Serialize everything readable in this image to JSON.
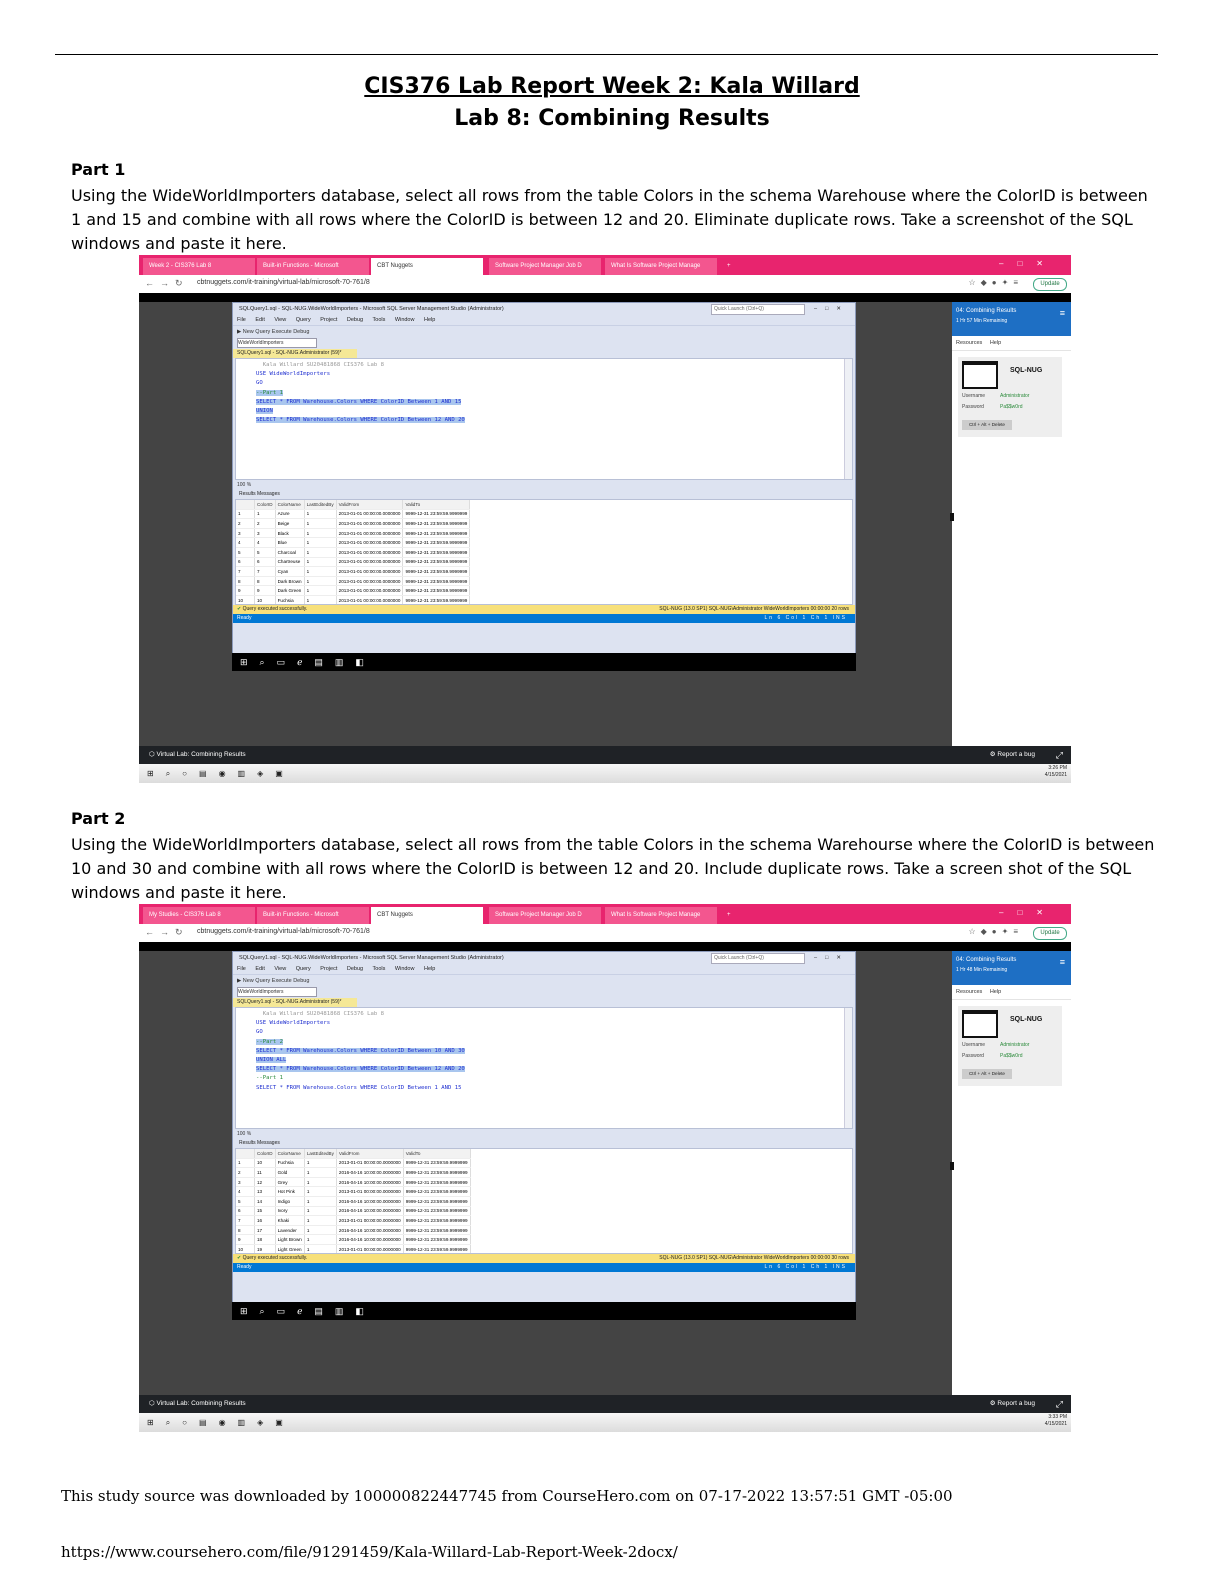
{
  "title1": "CIS376 Lab Report Week 2: Kala Willard",
  "title2": "Lab 8: Combining Results",
  "parts": [
    {
      "heading": "Part 1",
      "text": "Using the WideWorldImporters database, select all rows from the table Colors in the schema Warehouse where the ColorID is between 1 and 15 and combine with all rows where the ColorID is between 12 and 20. Eliminate duplicate rows. Take a screenshot of the SQL windows and paste it here.",
      "shot": {
        "tabs": [
          "Week 2 - CIS376 Lab 8",
          "Built-in Functions - Microsoft",
          "CBT Nuggets",
          "Software Project Manager Job D",
          "What Is Software Project Manage"
        ],
        "url": "cbtnuggets.com/it-training/virtual-lab/microsoft-70-761/8",
        "ssms_title": "SQLQuery1.sql - SQL-NUG.WideWorldImporters - Microsoft SQL Server Management Studio (Administrator)",
        "quick_launch": "Quick Launch (Ctrl+Q)",
        "menu": "File Edit View Query Project Debug Tools Window Help",
        "toolbar": "New Query   Execute   Debug",
        "db_selector": "WideWorldImporters",
        "doc_tab": "SQLQuery1.sql - SQL-NUG.Administrator (59)*",
        "code_lines": [
          {
            "text": "Kala Willard SU20481868 CIS376 Lab 8",
            "cls": "gr",
            "indent": "  "
          },
          {
            "text": "",
            "cls": "",
            "indent": ""
          },
          {
            "text": "USE WideWorldImporters",
            "cls": "kw",
            "indent": ""
          },
          {
            "text": "GO",
            "cls": "kw",
            "indent": ""
          },
          {
            "text": "",
            "cls": "",
            "indent": ""
          },
          {
            "text": "--Part 1",
            "cls": "cm hl",
            "indent": ""
          },
          {
            "text": "SELECT * FROM Warehouse.Colors WHERE ColorID Between 1 AND 15",
            "cls": "kw hl",
            "indent": ""
          },
          {
            "text": "UNION",
            "cls": "kw hl",
            "indent": ""
          },
          {
            "text": "SELECT * FROM Warehouse.Colors WHERE ColorID Between 12 AND 20",
            "cls": "kw hl",
            "indent": ""
          }
        ],
        "zoom": "100 %",
        "result_tabs": "Results   Messages",
        "columns": [
          "ColorID",
          "ColorName",
          "LastEditedBy",
          "ValidFrom",
          "ValidTo"
        ],
        "rows": [
          [
            "1",
            "1",
            "Azure",
            "1",
            "2013-01-01 00:00:00.0000000",
            "9999-12-31 23:59:59.9999999"
          ],
          [
            "2",
            "2",
            "Beige",
            "1",
            "2013-01-01 00:00:00.0000000",
            "9999-12-31 23:59:59.9999999"
          ],
          [
            "3",
            "3",
            "Black",
            "1",
            "2013-01-01 00:00:00.0000000",
            "9999-12-31 23:59:59.9999999"
          ],
          [
            "4",
            "4",
            "Blue",
            "1",
            "2013-01-01 00:00:00.0000000",
            "9999-12-31 23:59:59.9999999"
          ],
          [
            "5",
            "5",
            "Charcoal",
            "1",
            "2013-01-01 00:00:00.0000000",
            "9999-12-31 23:59:59.9999999"
          ],
          [
            "6",
            "6",
            "Chartreuse",
            "1",
            "2013-01-01 00:00:00.0000000",
            "9999-12-31 23:59:59.9999999"
          ],
          [
            "7",
            "7",
            "Cyan",
            "1",
            "2013-01-01 00:00:00.0000000",
            "9999-12-31 23:59:59.9999999"
          ],
          [
            "8",
            "8",
            "Dark Brown",
            "1",
            "2013-01-01 00:00:00.0000000",
            "9999-12-31 23:59:59.9999999"
          ],
          [
            "9",
            "9",
            "Dark Green",
            "1",
            "2013-01-01 00:00:00.0000000",
            "9999-12-31 23:59:59.9999999"
          ],
          [
            "10",
            "10",
            "Fuchsia",
            "1",
            "2013-01-01 00:00:00.0000000",
            "9999-12-31 23:59:59.9999999"
          ]
        ],
        "status_left": "Query executed successfully.",
        "status_right": "SQL-NUG (13.0 SP1)   SQL-NUG\\Administrator   WideWorldImporters   00:00:00   20 rows",
        "ready": "Ready",
        "ready_right": "Ln 6   Col 1   Ch 1   INS",
        "side_title": "04: Combining Results",
        "side_sub": "1 Hr 57 Min Remaining",
        "side_tabs": "Resources   Help",
        "machine": "SQL-NUG",
        "username_label": "Username",
        "username": "Administrator",
        "password_label": "Password",
        "password": "Pa$$w0rd",
        "cad_button": "Ctrl + Alt + Delete",
        "host_left": "Virtual Lab: Combining Results",
        "host_right": "Report a bug",
        "clock_time": "3:26 PM",
        "clock_date": "4/15/2021"
      }
    },
    {
      "heading": "Part 2",
      "text": "Using the WideWorldImporters database, select all rows from the table Colors in the schema Warehourse where the ColorID is between 10 and 30 and combine with all rows where the ColorID is between 12 and 20. Include duplicate rows. Take a screen shot of the SQL windows and paste it here.",
      "shot": {
        "tabs": [
          "My Studies - CIS376 Lab 8",
          "Built-in Functions - Microsoft",
          "CBT Nuggets",
          "Software Project Manager Job D",
          "What Is Software Project Manage"
        ],
        "url": "cbtnuggets.com/it-training/virtual-lab/microsoft-70-761/8",
        "ssms_title": "SQLQuery1.sql - SQL-NUG.WideWorldImporters - Microsoft SQL Server Management Studio (Administrator)",
        "quick_launch": "Quick Launch (Ctrl+Q)",
        "menu": "File Edit View Query Project Debug Tools Window Help",
        "toolbar": "New Query   Execute   Debug",
        "db_selector": "WideWorldImporters",
        "doc_tab": "SQLQuery1.sql - SQL-NUG.Administrator (59)*",
        "code_lines": [
          {
            "text": "Kala Willard SU20481868 CIS376 Lab 8",
            "cls": "gr",
            "indent": "  "
          },
          {
            "text": "",
            "cls": "",
            "indent": ""
          },
          {
            "text": "USE WideWorldImporters",
            "cls": "kw",
            "indent": ""
          },
          {
            "text": "GO",
            "cls": "kw",
            "indent": ""
          },
          {
            "text": "",
            "cls": "",
            "indent": ""
          },
          {
            "text": "--Part 2",
            "cls": "cm hl",
            "indent": ""
          },
          {
            "text": "SELECT * FROM Warehouse.Colors WHERE ColorID Between 10 AND 30",
            "cls": "kw hl",
            "indent": ""
          },
          {
            "text": "UNION ALL",
            "cls": "kw hl",
            "indent": ""
          },
          {
            "text": "SELECT * FROM Warehouse.Colors WHERE ColorID Between 12 AND 20",
            "cls": "kw hl",
            "indent": ""
          },
          {
            "text": "",
            "cls": "",
            "indent": ""
          },
          {
            "text": "--Part 1",
            "cls": "cm",
            "indent": ""
          },
          {
            "text": "SELECT * FROM Warehouse.Colors WHERE ColorID Between 1 AND 15",
            "cls": "kw",
            "indent": ""
          }
        ],
        "zoom": "100 %",
        "result_tabs": "Results   Messages",
        "columns": [
          "ColorID",
          "ColorName",
          "LastEditedBy",
          "ValidFrom",
          "ValidTo"
        ],
        "rows": [
          [
            "1",
            "10",
            "Fuchsia",
            "1",
            "2013-01-01 00:00:00.0000000",
            "9999-12-31 23:59:59.9999999"
          ],
          [
            "2",
            "11",
            "Gold",
            "1",
            "2016-04-16 10:00:00.0000000",
            "9999-12-31 23:59:59.9999999"
          ],
          [
            "3",
            "12",
            "Grey",
            "1",
            "2016-04-16 10:00:00.0000000",
            "9999-12-31 23:59:59.9999999"
          ],
          [
            "4",
            "13",
            "Hot Pink",
            "1",
            "2013-01-01 00:00:00.0000000",
            "9999-12-31 23:59:59.9999999"
          ],
          [
            "5",
            "14",
            "Indigo",
            "1",
            "2016-04-16 10:00:00.0000000",
            "9999-12-31 23:59:59.9999999"
          ],
          [
            "6",
            "15",
            "Ivory",
            "1",
            "2016-04-16 10:00:00.0000000",
            "9999-12-31 23:59:59.9999999"
          ],
          [
            "7",
            "16",
            "Khaki",
            "1",
            "2013-01-01 00:00:00.0000000",
            "9999-12-31 23:59:59.9999999"
          ],
          [
            "8",
            "17",
            "Lavender",
            "1",
            "2016-04-16 10:00:00.0000000",
            "9999-12-31 23:59:59.9999999"
          ],
          [
            "9",
            "18",
            "Light Brown",
            "1",
            "2016-04-16 10:00:00.0000000",
            "9999-12-31 23:59:59.9999999"
          ],
          [
            "10",
            "19",
            "Light Green",
            "1",
            "2013-01-01 00:00:00.0000000",
            "9999-12-31 23:59:59.9999999"
          ]
        ],
        "status_left": "Query executed successfully.",
        "status_right": "SQL-NUG (13.0 SP1)   SQL-NUG\\Administrator   WideWorldImporters   00:00:00   30 rows",
        "ready": "Ready",
        "ready_right": "Ln 6   Col 1   Ch 1   INS",
        "side_title": "04: Combining Results",
        "side_sub": "1 Hr 48 Min Remaining",
        "side_tabs": "Resources   Help",
        "machine": "SQL-NUG",
        "username_label": "Username",
        "username": "Administrator",
        "password_label": "Password",
        "password": "Pa$$w0rd",
        "cad_button": "Ctrl + Alt + Delete",
        "host_left": "Virtual Lab: Combining Results",
        "host_right": "Report a bug",
        "clock_time": "3:33 PM",
        "clock_date": "4/15/2021"
      }
    }
  ],
  "footer_source": "This study source was downloaded by 100000822447745 from CourseHero.com on 07-17-2022 13:57:51 GMT -05:00",
  "footer_url": "https://www.coursehero.com/file/91291459/Kala-Willard-Lab-Report-Week-2docx/"
}
